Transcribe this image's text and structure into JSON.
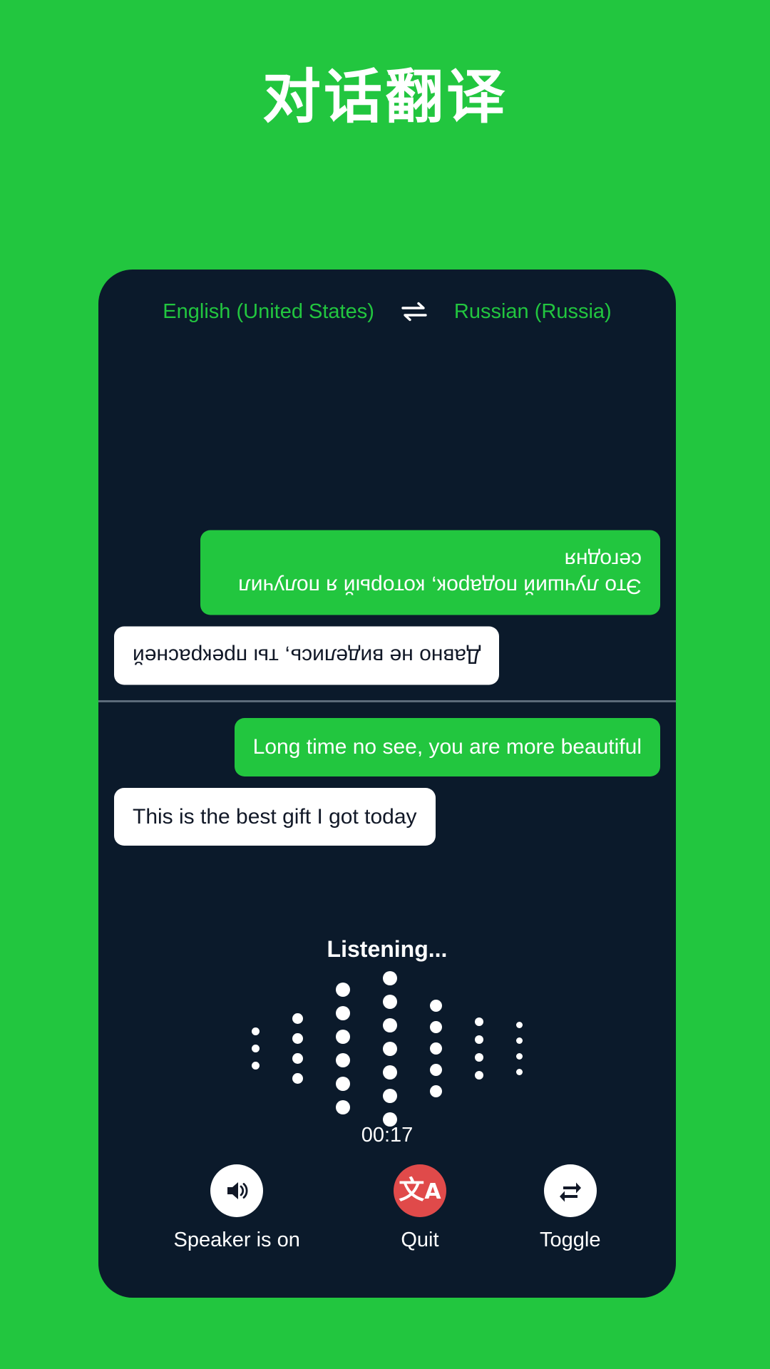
{
  "page": {
    "title": "对话翻译",
    "background_color": "#22C63F"
  },
  "colors": {
    "brand_green": "#22C63F",
    "phone_bg": "#0B1A2B",
    "bubble_white": "#FFFFFF",
    "quit_red": "#E04A4A",
    "divider": "#5C6B7A"
  },
  "language_bar": {
    "source_label": "English (United States)",
    "swap_icon": "swap-horizontal-icon",
    "target_label": "Russian (Russia)"
  },
  "top_pane": {
    "orientation": "rotated-180",
    "messages": [
      {
        "text": "Это лучший подарок, который я получил сегодня",
        "style": "green",
        "align": "left"
      },
      {
        "text": "Давно не виделись, ты прекрасней",
        "style": "white",
        "align": "right"
      }
    ]
  },
  "bottom_pane": {
    "orientation": "normal",
    "messages": [
      {
        "text": "Long time no see, you are more beautiful",
        "style": "green",
        "align": "right"
      },
      {
        "text": "This is the best gift I got today",
        "style": "white",
        "align": "left"
      }
    ]
  },
  "status": {
    "listening_label": "Listening...",
    "timer": "00:17"
  },
  "waveform": {
    "columns": [
      {
        "count": 3,
        "size": 11
      },
      {
        "count": 4,
        "size": 15
      },
      {
        "count": 6,
        "size": 20
      },
      {
        "count": 7,
        "size": 20
      },
      {
        "count": 5,
        "size": 17
      },
      {
        "count": 4,
        "size": 12
      },
      {
        "count": 4,
        "size": 9
      }
    ],
    "gap": 13,
    "dot_color": "#FFFFFF"
  },
  "controls": [
    {
      "label": "Speaker is on",
      "icon": "speaker-on-icon",
      "circle": "white"
    },
    {
      "label": "Quit",
      "icon": "translate-icon",
      "circle": "red"
    },
    {
      "label": "Toggle",
      "icon": "toggle-swap-icon",
      "circle": "white"
    }
  ]
}
